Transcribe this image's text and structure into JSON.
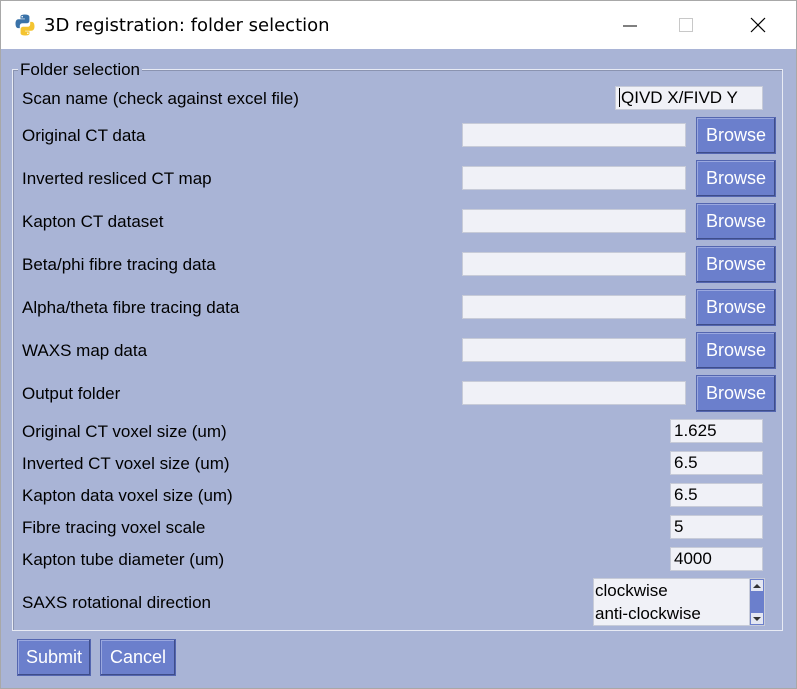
{
  "window": {
    "title": "3D registration: folder selection"
  },
  "form": {
    "legend": "Folder selection",
    "scan_name": {
      "label": "Scan name (check against excel file)",
      "value": "QIVD X/FIVD Y"
    },
    "folders": [
      {
        "label": "Original CT data",
        "value": "",
        "button": "Browse"
      },
      {
        "label": "Inverted resliced CT map",
        "value": "",
        "button": "Browse"
      },
      {
        "label": "Kapton CT dataset",
        "value": "",
        "button": "Browse"
      },
      {
        "label": "Beta/phi fibre tracing data",
        "value": "",
        "button": "Browse"
      },
      {
        "label": "Alpha/theta fibre tracing data",
        "value": "",
        "button": "Browse"
      },
      {
        "label": "WAXS map data",
        "value": "",
        "button": "Browse"
      },
      {
        "label": "Output folder",
        "value": "",
        "button": "Browse"
      }
    ],
    "numbers": [
      {
        "label": "Original CT voxel size (um)",
        "value": "1.625"
      },
      {
        "label": "Inverted CT voxel size (um)",
        "value": "6.5"
      },
      {
        "label": "Kapton data voxel size (um)",
        "value": "6.5"
      },
      {
        "label": "Fibre tracing voxel scale",
        "value": "5"
      },
      {
        "label": "Kapton tube diameter (um)",
        "value": "4000"
      }
    ],
    "saxs": {
      "label": "SAXS rotational direction",
      "options": [
        "clockwise",
        "anti-clockwise"
      ]
    }
  },
  "actions": {
    "submit": "Submit",
    "cancel": "Cancel"
  },
  "colors": {
    "background": "#a9b4d6",
    "button": "#6b7fcc",
    "input": "#f0f1f7"
  }
}
